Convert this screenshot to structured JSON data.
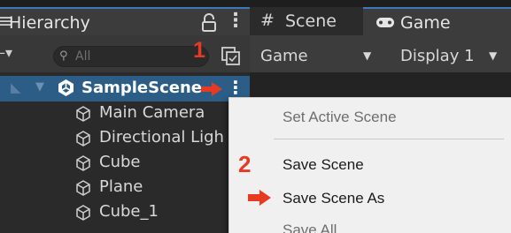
{
  "hierarchy": {
    "tab_title": "Hierarchy",
    "search_placeholder": "All",
    "tree": {
      "scene_name": "SampleScene",
      "children": [
        "Main Camera",
        "Directional Ligh",
        "Cube",
        "Plane",
        "Cube_1"
      ]
    }
  },
  "tabs": {
    "scene": "Scene",
    "game": "Game"
  },
  "game_toolbar": {
    "mode": "Game",
    "display": "Display 1"
  },
  "context_menu": {
    "items": [
      {
        "label": "Set Active Scene",
        "enabled": false
      },
      {
        "label": "Save Scene",
        "enabled": true
      },
      {
        "label": "Save Scene As",
        "enabled": true
      },
      {
        "label": "Save All",
        "enabled": false
      }
    ]
  },
  "annotations": {
    "step_1": "1",
    "step_2": "2"
  },
  "colors": {
    "selection": "#2c5d87",
    "annotation": "#e83a22",
    "tab_accent": "#3a79bb"
  },
  "icons": [
    "menu-icon",
    "lock-icon",
    "kebab-menu-icon",
    "search-icon",
    "scene-visibility-icon",
    "unity-scene-icon",
    "cube-icon",
    "hash-icon",
    "gamepad-icon",
    "red-arrow-icon"
  ]
}
